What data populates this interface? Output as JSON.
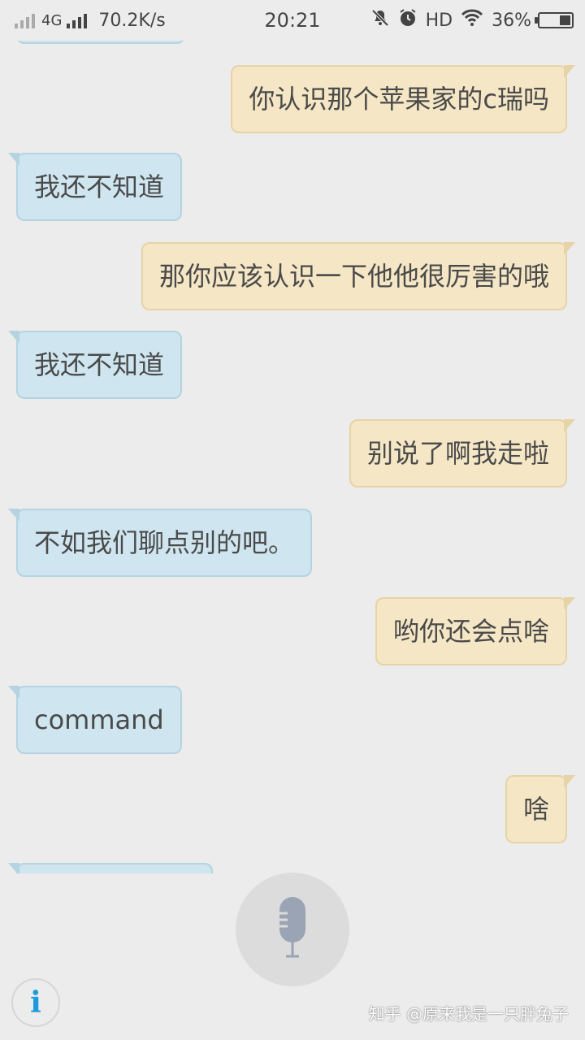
{
  "status_bar": {
    "network": "4G",
    "speed": "70.2K/s",
    "time": "20:21",
    "hd": "HD",
    "battery": "36%",
    "battery_level": 0.36
  },
  "messages": [
    {
      "side": "sent",
      "text": "你认识那个苹果家的c瑞吗"
    },
    {
      "side": "recv",
      "text": "我还不知道"
    },
    {
      "side": "sent",
      "text": "那你应该认识一下他他很厉害的哦"
    },
    {
      "side": "recv",
      "text": "我还不知道"
    },
    {
      "side": "sent",
      "text": "别说了啊我走啦"
    },
    {
      "side": "recv",
      "text": "不如我们聊点别的吧。"
    },
    {
      "side": "sent",
      "text": "哟你还会点啥"
    },
    {
      "side": "recv",
      "text": "command"
    },
    {
      "side": "sent",
      "text": "啥"
    }
  ],
  "bottom": {
    "mic_icon": "microphone-icon",
    "info_icon": "info-icon",
    "info_glyph": "i"
  },
  "watermark": "知乎 @原来我是一只胖兔子",
  "colors": {
    "background": "#ececec",
    "sent_bubble": "#f5e7c5",
    "recv_bubble": "#cfe6f0",
    "info_accent": "#1e9be0"
  }
}
